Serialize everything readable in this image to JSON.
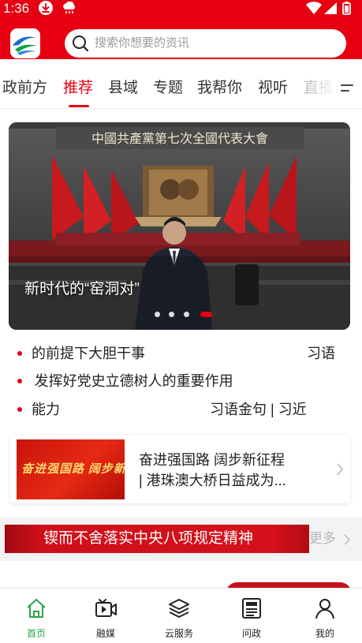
{
  "status_bar": {
    "time": "1:36",
    "icons": [
      "download-icon",
      "cloud-icon",
      "wifi-icon",
      "signal-icon",
      "battery-icon"
    ]
  },
  "header": {
    "logo_icon": "app-logo-icon",
    "search_placeholder": "搜索你想要的资讯",
    "accent_color": "#e60012"
  },
  "tabs": [
    {
      "label": "政前方",
      "active": false
    },
    {
      "label": "推荐",
      "active": true
    },
    {
      "label": "县域",
      "active": false
    },
    {
      "label": "专题",
      "active": false
    },
    {
      "label": "我帮你",
      "active": false
    },
    {
      "label": "视听",
      "active": false
    },
    {
      "label": "直播",
      "active": false
    }
  ],
  "banner": {
    "caption": "新时代的“窑洞对”",
    "backdrop_text": "中國共產黨第七次全國代表大會",
    "slide_count": 4,
    "active_slide": 4
  },
  "news": [
    {
      "left": "的前提下大胆干事",
      "right": "习语"
    },
    {
      "left": "|   发挥好党史立德树人的重要作用",
      "right": ""
    },
    {
      "left": "能力",
      "right": "习语金句   |   习近"
    }
  ],
  "promo": {
    "image_text": "奋进强国路 阔步新征程",
    "text_line1": "奋进强国路   阔步新征程",
    "text_line2": "|   港珠澳大桥日益成为..."
  },
  "section": {
    "title": "锲而不舍落实中央八项规定精神",
    "more_label": "更多"
  },
  "bottom_nav": [
    {
      "label": "首页",
      "icon": "home-icon",
      "active": true
    },
    {
      "label": "融媒",
      "icon": "video-icon",
      "active": false
    },
    {
      "label": "云服务",
      "icon": "layers-icon",
      "active": false
    },
    {
      "label": "问政",
      "icon": "newspaper-icon",
      "active": false
    },
    {
      "label": "我的",
      "icon": "person-icon",
      "active": false
    }
  ],
  "colors": {
    "brand_red": "#e60012",
    "active_green": "#2aa54a"
  }
}
